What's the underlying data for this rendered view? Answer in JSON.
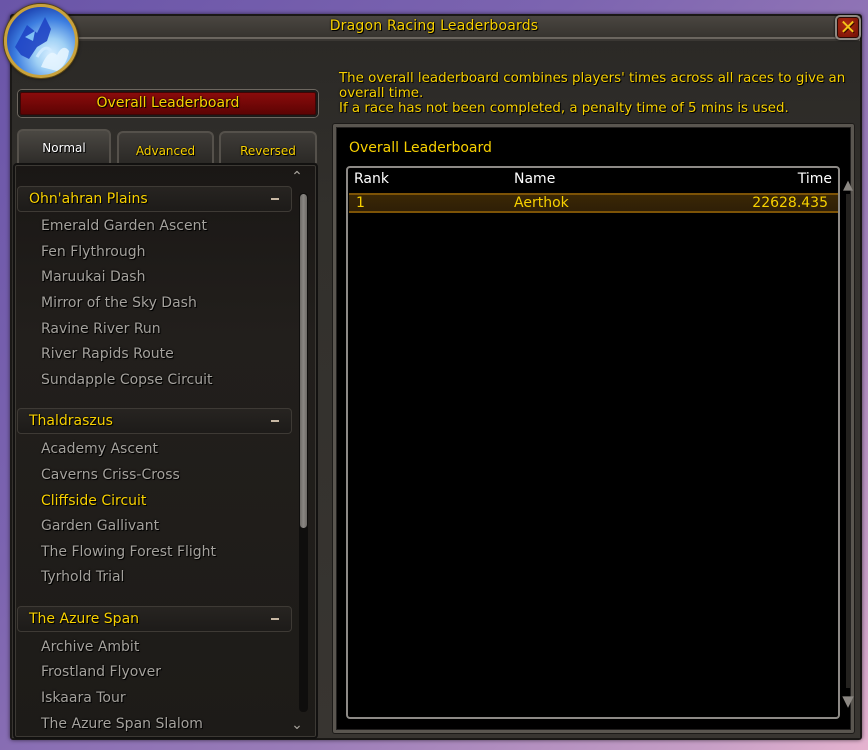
{
  "window": {
    "title": "Dragon Racing Leaderboards",
    "close_label": "✕",
    "emblem_icon": "dragon-emblem-icon"
  },
  "left_panel": {
    "overall_button": "Overall Leaderboard",
    "tabs": [
      {
        "label": "Normal",
        "active": true
      },
      {
        "label": "Advanced",
        "active": false
      },
      {
        "label": "Reversed",
        "active": false
      }
    ],
    "scroll_up_icon": "⌃",
    "scroll_down_icon": "⌄",
    "scroll_position": 0.0,
    "zones": [
      {
        "name": "Ohn'ahran Plains",
        "collapse_icon": "minus-icon",
        "races": [
          "Emerald Garden Ascent",
          "Fen Flythrough",
          "Maruukai Dash",
          "Mirror of the Sky Dash",
          "Ravine River Run",
          "River Rapids Route",
          "Sundapple Copse Circuit"
        ]
      },
      {
        "name": "Thaldraszus",
        "collapse_icon": "minus-icon",
        "races": [
          "Academy Ascent",
          "Caverns Criss-Cross",
          "Cliffside Circuit",
          "Garden Gallivant",
          "The Flowing Forest Flight",
          "Tyrhold Trial"
        ]
      },
      {
        "name": "The Azure Span",
        "collapse_icon": "minus-icon",
        "races": [
          "Archive Ambit",
          "Frostland Flyover",
          "Iskaara Tour",
          "The Azure Span Slalom"
        ]
      }
    ],
    "highlighted_race": "Cliffside Circuit"
  },
  "right_panel": {
    "description_line1": "The overall leaderboard combines players' times across all races to give an overall time.",
    "description_line2": "If a race has not been completed, a penalty time of 5 mins is used.",
    "leaderboard_title": "Overall Leaderboard",
    "columns": {
      "rank": "Rank",
      "name": "Name",
      "time": "Time"
    },
    "rows": [
      {
        "rank": "1",
        "name": "Aerthok",
        "time": "22628.435"
      }
    ]
  },
  "colors": {
    "gold_text": "#f8d100",
    "race_text": "#a5a29d",
    "header_text": "#ffffff",
    "button_red": "#8c0c0c",
    "row_highlight": "#3a2705"
  }
}
